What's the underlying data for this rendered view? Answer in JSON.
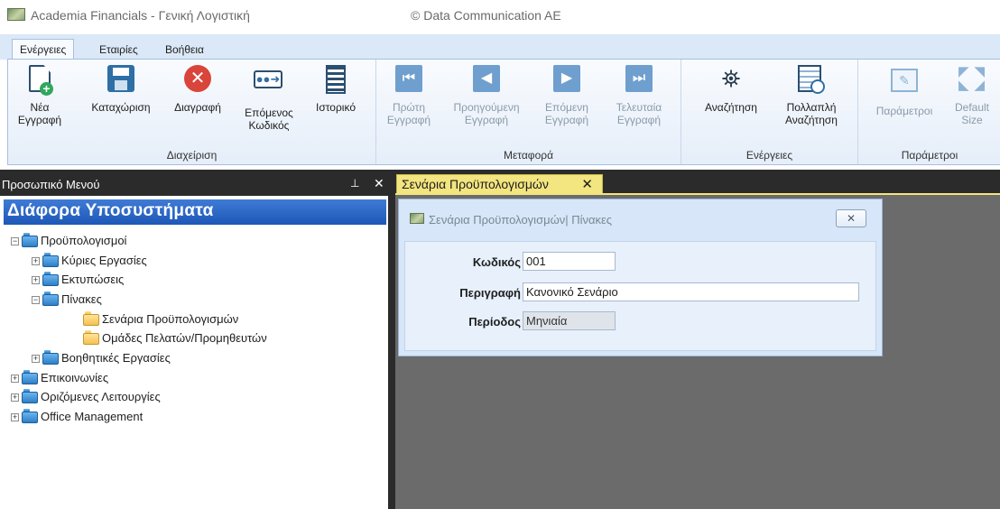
{
  "app": {
    "title": "Academia Financials - Γενική Λογιστική",
    "copyright": "© Data Communication AE"
  },
  "menu": {
    "tabs": [
      {
        "label": "Ενέργειες",
        "active": true
      },
      {
        "label": "Εταιρίες",
        "active": false
      },
      {
        "label": "Βοήθεια",
        "active": false
      }
    ]
  },
  "ribbon": {
    "groups": [
      {
        "label": "Διαχείριση",
        "buttons": [
          {
            "label1": "Νέα",
            "label2": "Εγγραφή",
            "icon": "new-record-icon",
            "enabled": true
          },
          {
            "label1": "Καταχώριση",
            "label2": "",
            "icon": "save-icon",
            "enabled": true
          },
          {
            "label1": "Διαγραφή",
            "label2": "",
            "icon": "delete-icon",
            "enabled": true
          },
          {
            "label1": "Επόμενος",
            "label2": "Κωδικός",
            "icon": "next-code-icon",
            "enabled": true
          },
          {
            "label1": "Ιστορικό",
            "label2": "",
            "icon": "history-icon",
            "enabled": true
          }
        ]
      },
      {
        "label": "Μεταφορά",
        "buttons": [
          {
            "label1": "Πρώτη",
            "label2": "Εγγραφή",
            "icon": "first-record-icon",
            "enabled": false
          },
          {
            "label1": "Προηγούμενη",
            "label2": "Εγγραφή",
            "icon": "previous-record-icon",
            "enabled": false
          },
          {
            "label1": "Επόμενη",
            "label2": "Εγγραφή",
            "icon": "next-record-icon",
            "enabled": false
          },
          {
            "label1": "Τελευταία",
            "label2": "Εγγραφή",
            "icon": "last-record-icon",
            "enabled": false
          }
        ]
      },
      {
        "label": "Ενέργειες",
        "buttons": [
          {
            "label1": "Αναζήτηση",
            "label2": "",
            "icon": "binoculars-icon",
            "enabled": true
          },
          {
            "label1": "Πολλαπλή",
            "label2": "Αναζήτηση",
            "icon": "multi-search-icon",
            "enabled": true
          }
        ]
      },
      {
        "label": "Παράμετροι",
        "buttons": [
          {
            "label1": "Παράμετροι",
            "label2": "",
            "icon": "parameters-icon",
            "enabled": false
          },
          {
            "label1": "Default",
            "label2": "Size",
            "icon": "default-size-icon",
            "enabled": false
          }
        ]
      }
    ]
  },
  "panel": {
    "title": "Προσωπικό Μενού",
    "pin": "⊥",
    "close": "✕",
    "module_title": "Διάφορα Υποσυστήματα",
    "tree": [
      {
        "label": "Προϋπολογισμοί",
        "level": 0,
        "expander": "−",
        "folder": "blue"
      },
      {
        "label": "Κύριες Εργασίες",
        "level": 1,
        "expander": "+",
        "folder": "blue"
      },
      {
        "label": "Εκτυπώσεις",
        "level": 1,
        "expander": "+",
        "folder": "blue"
      },
      {
        "label": "Πίνακες",
        "level": 1,
        "expander": "−",
        "folder": "blue"
      },
      {
        "label": "Σενάρια Προϋπολογισμών",
        "level": 2,
        "expander": "",
        "folder": "yellow"
      },
      {
        "label": "Ομάδες Πελατών/Προμηθευτών",
        "level": 2,
        "expander": "",
        "folder": "yellow"
      },
      {
        "label": "Βοηθητικές Εργασίες",
        "level": 1,
        "expander": "+",
        "folder": "blue"
      },
      {
        "label": "Επικοινωνίες",
        "level": 0,
        "expander": "+",
        "folder": "blue"
      },
      {
        "label": "Οριζόμενες Λειτουργίες",
        "level": 0,
        "expander": "+",
        "folder": "blue"
      },
      {
        "label": "Office Management",
        "level": 0,
        "expander": "+",
        "folder": "blue"
      }
    ]
  },
  "document_tab": {
    "label": "Σενάρια Προϋπολογισμών",
    "close": "✕"
  },
  "dialog": {
    "title": "Σενάρια Προϋπολογισμών| Πίνακες",
    "close": "✕",
    "fields": {
      "code": {
        "label": "Κωδικός",
        "value": "001"
      },
      "description": {
        "label": "Περιγραφή",
        "value": "Κανονικό Σενάριο"
      },
      "period": {
        "label": "Περίοδος",
        "value": "Μηνιαία"
      }
    }
  },
  "colors": {
    "accent_blue": "#2f6fc4",
    "tab_yellow": "#f3e57f",
    "delete_red": "#d9443b",
    "workspace_dark": "#2b2b2b"
  }
}
